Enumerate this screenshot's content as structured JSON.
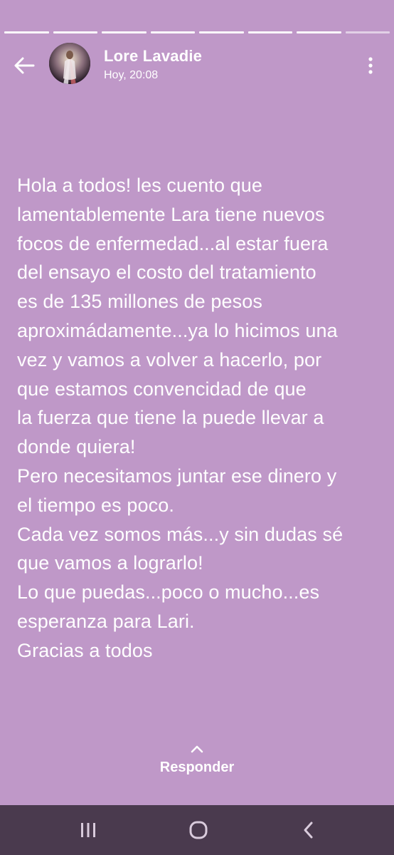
{
  "story": {
    "progress_total": 8,
    "progress_completed": 7,
    "author_name": "Lore Lavadie",
    "timestamp": "Hoy, 20:08",
    "background_color": "#bf98c8",
    "message": "Hola a todos! les cuento que\nlamentablemente Lara tiene nuevos\nfocos de enfermedad...al estar fuera\ndel ensayo el costo del tratamiento\nes de 135 millones de pesos\naproximádamente...ya lo hicimos una\nvez y vamos a volver a hacerlo, por\nque estamos convencidad de que\nla fuerza que tiene la puede llevar a\ndonde quiera!\nPero necesitamos juntar ese dinero y\nel tiempo es poco.\nCada vez somos más...y sin dudas sé\nque vamos a lograrlo!\nLo que puedas...poco o mucho...es\nesperanza para Lari.\nGracias a todos",
    "reply_label": "Responder"
  },
  "icons": {
    "back": "arrow-left-icon",
    "more": "more-vertical-icon",
    "reply": "chevron-up-icon",
    "nav_recent": "recent-apps-icon",
    "nav_home": "home-icon",
    "nav_back": "nav-back-icon"
  },
  "navbar": {
    "color": "#4a3a4e"
  }
}
